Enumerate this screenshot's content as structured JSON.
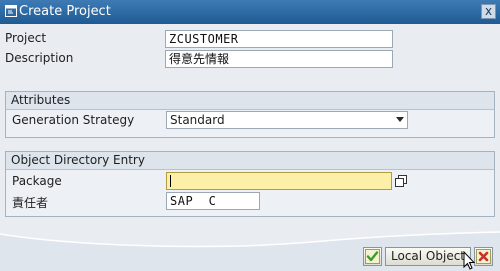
{
  "window": {
    "title": "Create Project",
    "close_glyph": "x"
  },
  "fields": {
    "project_label": "Project",
    "project_value": "ZCUSTOMER",
    "description_label": "Description",
    "description_value": "得意先情報"
  },
  "attributes": {
    "group_title": "Attributes",
    "generation_strategy_label": "Generation Strategy",
    "generation_strategy_value": "Standard"
  },
  "object_directory": {
    "group_title": "Object Directory Entry",
    "package_label": "Package",
    "package_value": "",
    "person_label": "責任者",
    "person_value": "SAP  C"
  },
  "buttons": {
    "local_object_label": "Local Object"
  },
  "colors": {
    "titlebar": "#2e6aa5",
    "focused_field": "#fcefa8",
    "confirm_green": "#3d9a2f",
    "cancel_red": "#c8312a"
  },
  "icons": [
    "window-icon",
    "close-icon",
    "chevron-down-icon",
    "value-help-icon",
    "checkmark-icon",
    "cancel-icon",
    "mouse-pointer-icon"
  ]
}
